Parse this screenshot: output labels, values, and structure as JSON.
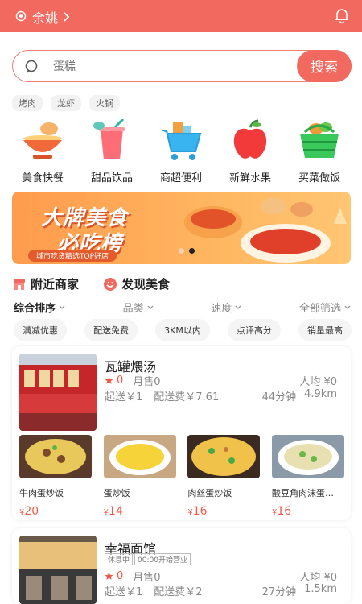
{
  "topbar": {
    "location": "余姚",
    "bg": "#f26a5f"
  },
  "search": {
    "placeholder": "蛋糕",
    "button": "搜索"
  },
  "hot_tags": [
    "烤肉",
    "龙虾",
    "火锅"
  ],
  "categories": [
    {
      "label": "美食快餐",
      "icon": "rice-bowl-icon"
    },
    {
      "label": "甜品饮品",
      "icon": "drink-cup-icon"
    },
    {
      "label": "商超便利",
      "icon": "shopping-cart-icon"
    },
    {
      "label": "新鲜水果",
      "icon": "apple-icon"
    },
    {
      "label": "买菜做饭",
      "icon": "vegetable-basket-icon"
    }
  ],
  "banner": {
    "line1": "大牌美食",
    "line2": "必吃榜",
    "sub": "城市吃货精选TOP好店"
  },
  "section_tabs": [
    "附近商家",
    "发现美食"
  ],
  "sorts": [
    "综合排序",
    "品类",
    "速度",
    "全部筛选"
  ],
  "filters": [
    "满减优惠",
    "配送免费",
    "3KM以内",
    "点评高分",
    "销量最高"
  ],
  "shops": [
    {
      "name": "瓦罐煨汤",
      "rating": "0",
      "sales": "月售0",
      "avg": "人均 ¥0",
      "min_order": "起送￥1",
      "delivery_fee": "配送费￥7.61",
      "time": "44分钟",
      "distance": "4.9km",
      "dishes": [
        {
          "name": "牛肉蛋炒饭",
          "currency": "¥",
          "price": "20"
        },
        {
          "name": "蛋炒饭",
          "currency": "¥",
          "price": "14"
        },
        {
          "name": "肉丝蛋炒饭",
          "currency": "¥",
          "price": "16"
        },
        {
          "name": "酸豆角肉沫蛋…",
          "currency": "¥",
          "price": "16"
        }
      ]
    },
    {
      "name": "幸福面馆",
      "badge_status": "休息中",
      "badge_time": "00:00开始营业",
      "rating": "0",
      "sales": "月售0",
      "avg": "人均 ¥0",
      "min_order": "起送￥1",
      "delivery_fee": "配送费￥2",
      "time": "27分钟",
      "distance": "1.5km"
    }
  ]
}
